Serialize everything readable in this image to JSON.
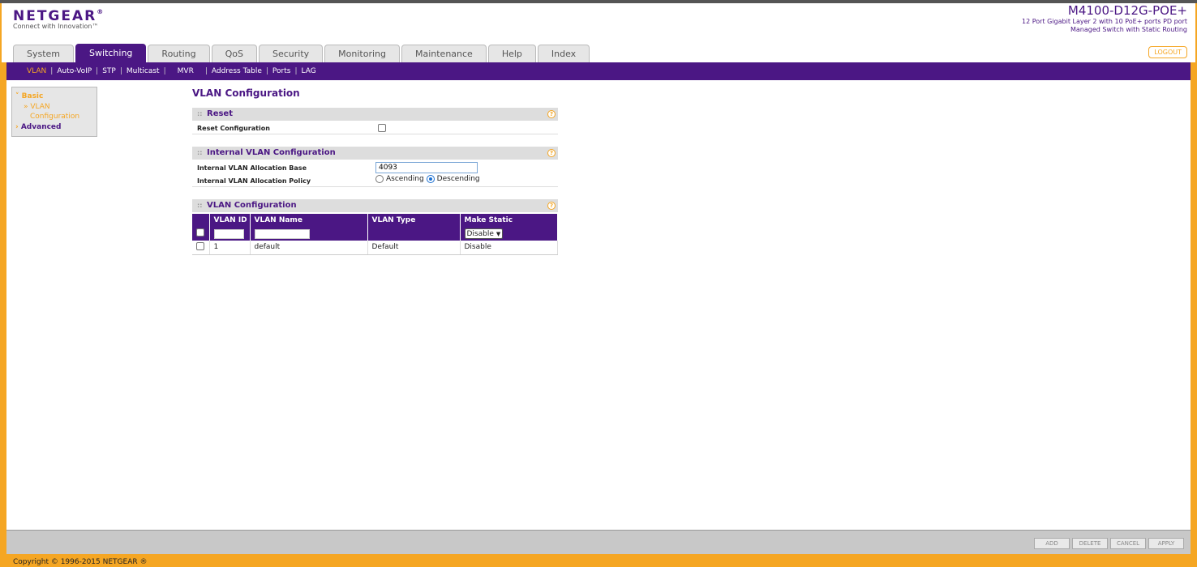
{
  "brand": {
    "logo": "NETGEAR",
    "logo_mark": "®",
    "tagline": "Connect with Innovation™",
    "model": "M4100-D12G-POE+",
    "model_desc_line1": "12 Port Gigabit Layer 2 with 10 PoE+ ports PD port",
    "model_desc_line2": "Managed Switch with Static Routing",
    "logout": "LOGOUT"
  },
  "tabs": [
    "System",
    "Switching",
    "Routing",
    "QoS",
    "Security",
    "Monitoring",
    "Maintenance",
    "Help",
    "Index"
  ],
  "active_tab": "Switching",
  "subnav": [
    "VLAN",
    "Auto-VoIP",
    "STP",
    "Multicast",
    "MVR",
    "Address Table",
    "Ports",
    "LAG"
  ],
  "sidebar": {
    "basic": "Basic",
    "item_line1": "VLAN",
    "item_line2": "Configuration",
    "advanced": "Advanced"
  },
  "page_title": "VLAN Configuration",
  "reset_section": {
    "title": "Reset",
    "field_label": "Reset Configuration"
  },
  "internal_section": {
    "title": "Internal VLAN Configuration",
    "base_label": "Internal VLAN Allocation Base",
    "base_value": "4093",
    "policy_label": "Internal VLAN Allocation Policy",
    "opt_ascending": "Ascending",
    "opt_descending": "Descending",
    "selected_policy": "Descending"
  },
  "vlan_section": {
    "title": "VLAN Configuration",
    "columns": [
      "VLAN ID",
      "VLAN Name",
      "VLAN Type",
      "Make Static"
    ],
    "edit_select": "Disable",
    "rows": [
      {
        "id": "1",
        "name": "default",
        "type": "Default",
        "static": "Disable"
      }
    ]
  },
  "buttons": [
    "ADD",
    "DELETE",
    "CANCEL",
    "APPLY"
  ],
  "copyright": "Copyright © 1996-2015 NETGEAR ®",
  "colors": {
    "primary": "#4b1784",
    "accent": "#f5a623"
  }
}
